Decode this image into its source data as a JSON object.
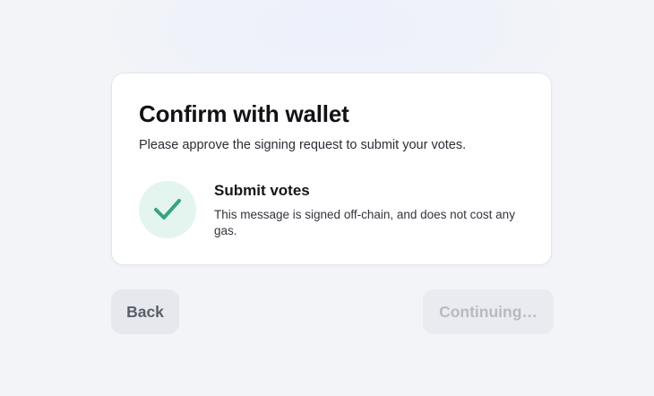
{
  "dialog": {
    "title": "Confirm with wallet",
    "subtitle": "Please approve the signing request to submit your votes."
  },
  "step": {
    "icon": "checkmark-icon",
    "status": "complete",
    "title": "Submit votes",
    "description": "This message is signed off-chain, and does not cost any gas."
  },
  "actions": {
    "back_label": "Back",
    "continue_label": "Continuing…",
    "continue_disabled": true
  },
  "colors": {
    "check_green": "#3aa37f",
    "check_bg": "#e4f5ef",
    "button_bg": "#e6e8ee"
  }
}
